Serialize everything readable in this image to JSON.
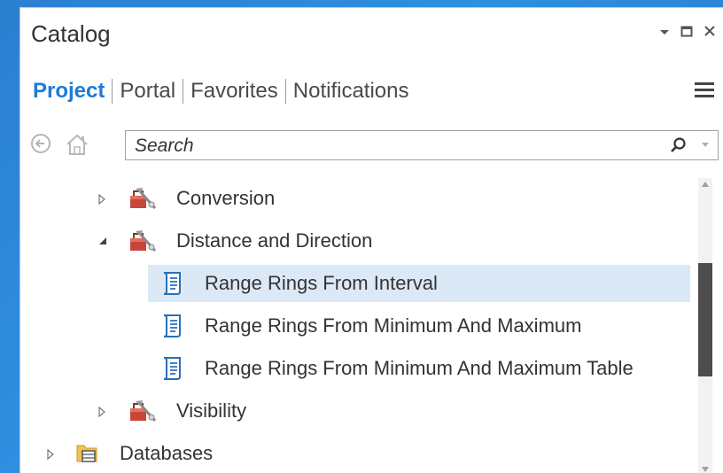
{
  "window": {
    "title": "Catalog",
    "controls": [
      "auto-hide-dropdown",
      "maximize",
      "close"
    ]
  },
  "tabs": [
    {
      "label": "Project",
      "active": true
    },
    {
      "label": "Portal",
      "active": false
    },
    {
      "label": "Favorites",
      "active": false
    },
    {
      "label": "Notifications",
      "active": false
    }
  ],
  "nav": {
    "back_icon": "back-arrow-icon",
    "home_icon": "home-icon",
    "search": {
      "placeholder": "Search",
      "value": ""
    }
  },
  "tree": {
    "items": [
      {
        "label": "Conversion",
        "level": 1,
        "expanded": false,
        "icon": "toolbox-icon",
        "selected": false
      },
      {
        "label": "Distance and Direction",
        "level": 1,
        "expanded": true,
        "icon": "toolbox-icon",
        "selected": false
      },
      {
        "label": "Range Rings From Interval",
        "level": 2,
        "icon": "script-tool-icon",
        "selected": true
      },
      {
        "label": "Range Rings From Minimum And Maximum",
        "level": 2,
        "icon": "script-tool-icon",
        "selected": false
      },
      {
        "label": "Range Rings From Minimum And Maximum Table",
        "level": 2,
        "icon": "script-tool-icon",
        "selected": false
      },
      {
        "label": "Visibility",
        "level": 1,
        "expanded": false,
        "icon": "toolbox-icon",
        "selected": false
      },
      {
        "label": "Databases",
        "level": 0,
        "expanded": false,
        "icon": "database-folder-icon",
        "selected": false
      }
    ]
  },
  "colors": {
    "accent": "#1c7cd5",
    "selection": "#dbe9f6",
    "background": "#2b7fd0"
  }
}
